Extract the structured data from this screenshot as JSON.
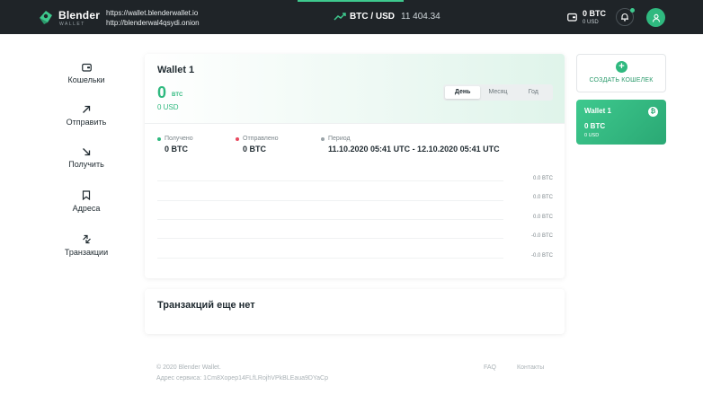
{
  "header": {
    "brand": "Blender",
    "brand_sub": "WALLET",
    "url_clear": "https://wallet.blenderwallet.io",
    "url_onion": "http://blenderwal4qsydi.onion",
    "pair": "BTC / USD",
    "price": "11 404.34",
    "balance_btc": "0 BTC",
    "balance_usd": "0 USD",
    "accent_color": "#3ec98e"
  },
  "sidebar": {
    "items": [
      {
        "label": "Кошельки",
        "icon": "wallet-icon"
      },
      {
        "label": "Отправить",
        "icon": "arrow-up-right-icon"
      },
      {
        "label": "Получить",
        "icon": "arrow-down-right-icon"
      },
      {
        "label": "Адреса",
        "icon": "bookmark-icon"
      },
      {
        "label": "Транзакции",
        "icon": "swap-arrows-icon"
      }
    ]
  },
  "wallet": {
    "title": "Wallet 1",
    "amount": "0",
    "unit": "BTC",
    "usd": "0 USD",
    "periods": [
      "День",
      "Месяц",
      "Год"
    ],
    "active_period": "День",
    "received_label": "Получено",
    "received_value": "0 BTC",
    "sent_label": "Отправлено",
    "sent_value": "0 BTC",
    "period_label": "Период",
    "period_value": "11.10.2020 05:41 UTC - 12.10.2020 05:41 UTC",
    "received_color": "#2fb97f",
    "sent_color": "#e84a5f",
    "period_color": "#9aa3a8"
  },
  "chart_data": {
    "type": "line",
    "y_ticks": [
      "0.0 BTC",
      "0.0 BTC",
      "0.0 BTC",
      "-0.0 BTC",
      "-0.0 BTC"
    ],
    "series": []
  },
  "transactions": {
    "empty_label": "Транзакций еще нет"
  },
  "right": {
    "create_label": "СОЗДАТЬ КОШЕЛЕК",
    "wallet_name": "Wallet 1",
    "wallet_btc": "0 BTC",
    "wallet_usd": "0 USD",
    "coin_glyph": "₿"
  },
  "footer": {
    "copyright": "© 2020 Blender Wallet.",
    "service_address": "Адрес сервиса: 1Cm8Xopep14FLfLRojhVPkBLEaua9DYaCp",
    "faq": "FAQ",
    "contacts": "Контакты"
  }
}
